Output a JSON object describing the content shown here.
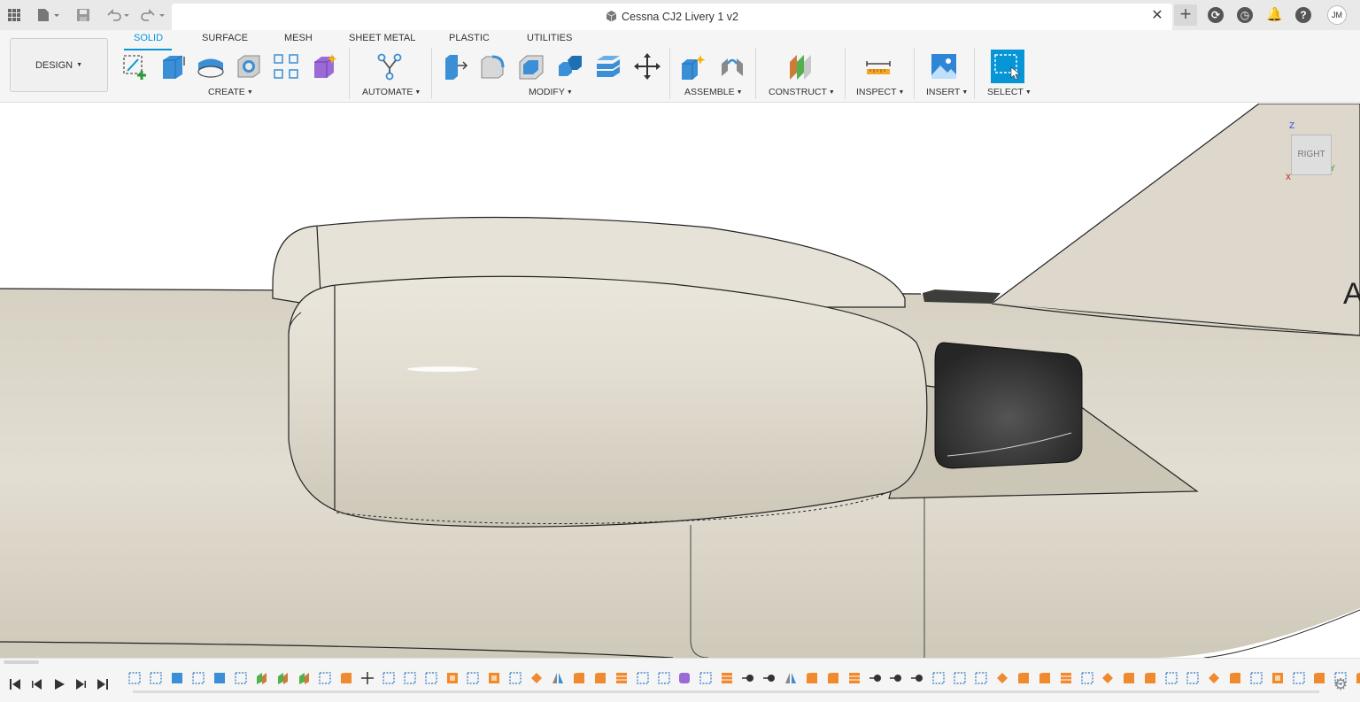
{
  "app": {
    "document_title": "Cessna CJ2 Livery 1 v2",
    "user_initials": "JM",
    "workspace": "DESIGN"
  },
  "toolbar_icons": [
    "apps-grid-icon",
    "file-icon",
    "save-icon",
    "undo-icon",
    "redo-icon"
  ],
  "tabs": [
    {
      "label": "SOLID",
      "active": true
    },
    {
      "label": "SURFACE",
      "active": false
    },
    {
      "label": "MESH",
      "active": false
    },
    {
      "label": "SHEET METAL",
      "active": false
    },
    {
      "label": "PLASTIC",
      "active": false
    },
    {
      "label": "UTILITIES",
      "active": false
    }
  ],
  "groups": {
    "create": "CREATE",
    "automate": "AUTOMATE",
    "modify": "MODIFY",
    "assemble": "ASSEMBLE",
    "construct": "CONSTRUCT",
    "inspect": "INSPECT",
    "insert": "INSERT",
    "select": "SELECT"
  },
  "viewcube": {
    "face": "RIGHT",
    "axis_z": "Z",
    "axis_y": "Y",
    "axis_x": "X"
  },
  "viewport": {
    "edge_text": "A"
  },
  "colors": {
    "accent": "#0696d7",
    "body": "#dcd7ca",
    "dark_part": "#3d3d3b"
  }
}
